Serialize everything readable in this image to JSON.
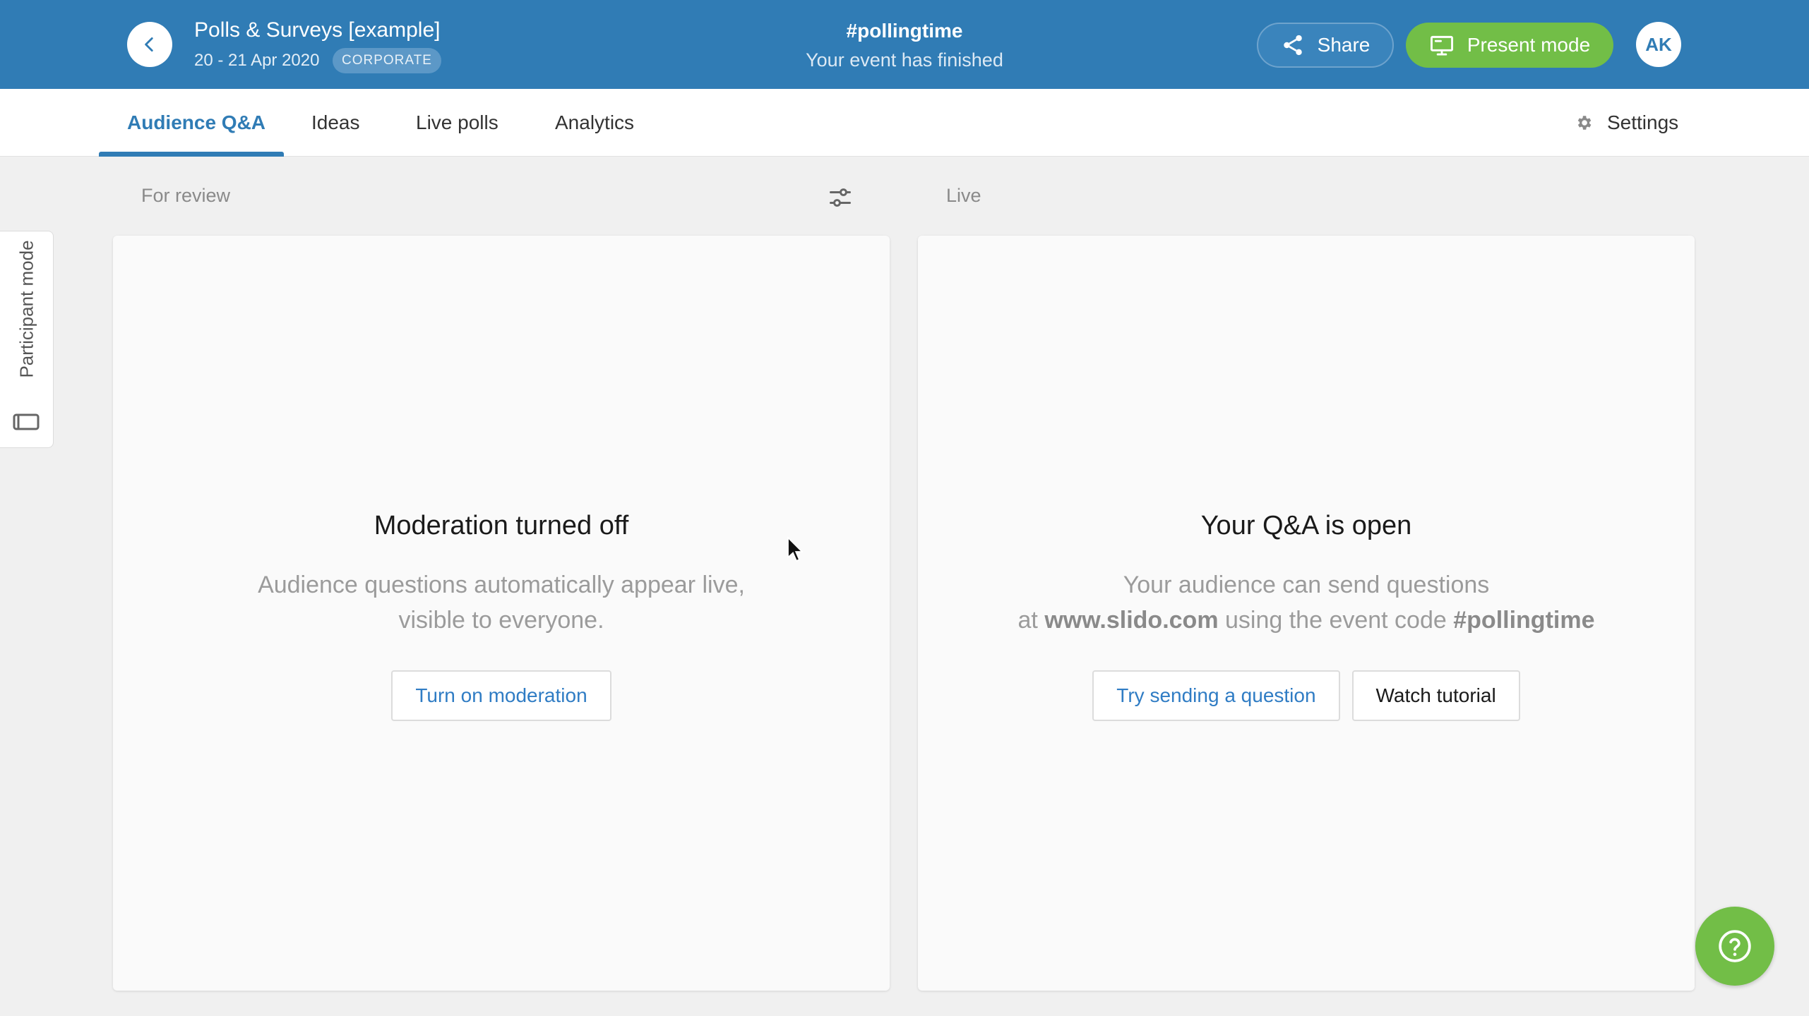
{
  "header": {
    "event_title": "Polls & Surveys [example]",
    "event_dates": "20 - 21 Apr 2020",
    "badge": "CORPORATE",
    "event_code": "#pollingtime",
    "status": "Your event has finished",
    "share_label": "Share",
    "present_label": "Present mode",
    "avatar_initials": "AK"
  },
  "tabs": [
    {
      "label": "Audience Q&A",
      "active": true
    },
    {
      "label": "Ideas",
      "active": false
    },
    {
      "label": "Live polls",
      "active": false
    },
    {
      "label": "Analytics",
      "active": false
    }
  ],
  "settings_label": "Settings",
  "side_tab": {
    "label": "Participant mode"
  },
  "left_column": {
    "label": "For review",
    "title": "Moderation turned off",
    "text_line1": "Audience questions automatically appear live,",
    "text_line2": "visible to everyone.",
    "button": "Turn on moderation"
  },
  "right_column": {
    "label": "Live",
    "title": "Your Q&A is open",
    "text_line1": "Your audience can send questions",
    "text_at": "at",
    "text_site": "www.slido.com",
    "text_mid": "using the event code",
    "text_code": "#pollingtime",
    "button_primary": "Try sending a question",
    "button_secondary": "Watch tutorial"
  },
  "colors": {
    "header_bg": "#307cb5",
    "accent_green": "#72be47",
    "link_blue": "#2f7cc4"
  },
  "icons": [
    "back-chevron-icon",
    "share-icon",
    "monitor-icon",
    "gear-icon",
    "filter-sliders-icon",
    "participant-screen-icon",
    "help-question-icon",
    "mouse-cursor-icon"
  ]
}
